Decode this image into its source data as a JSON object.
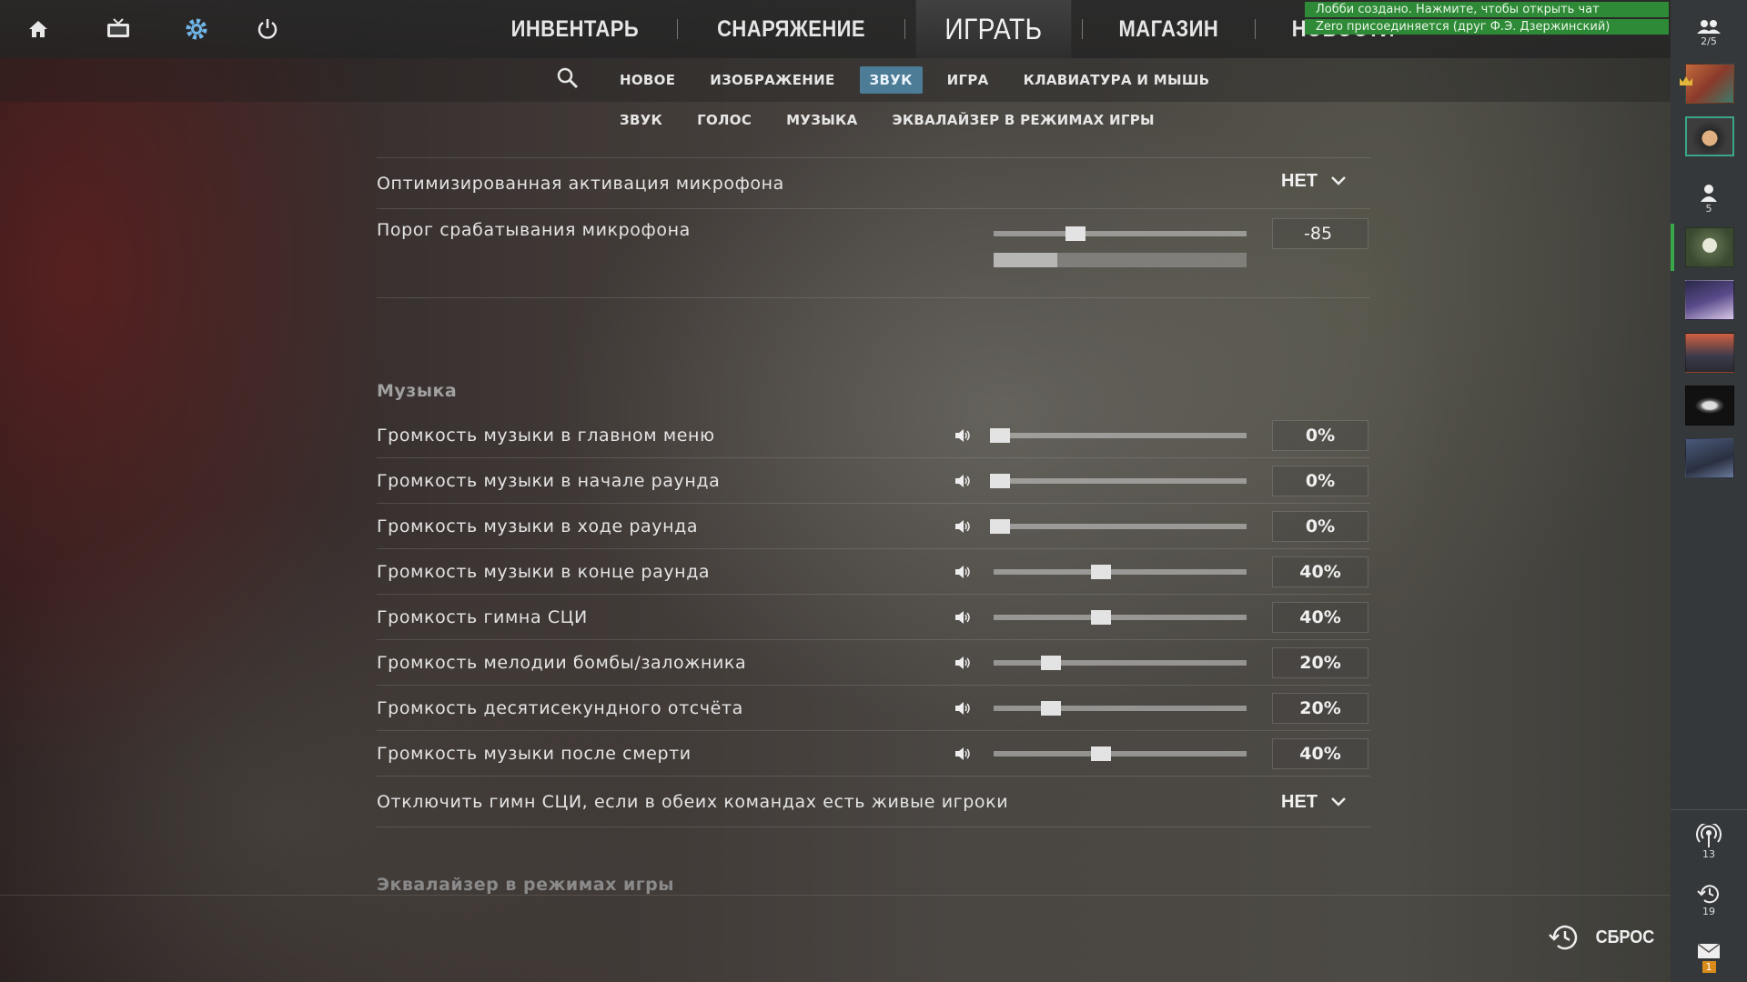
{
  "notifications": [
    "Лобби создано. Нажмите, чтобы открыть чат",
    "Zero присоединяется (друг Ф.Э. Дзержинский)"
  ],
  "top_icons": [
    "home-icon",
    "tv-icon",
    "gear-icon",
    "power-icon"
  ],
  "main_nav": {
    "inventory": "ИНВЕНТАРЬ",
    "loadout": "СНАРЯЖЕНИЕ",
    "play": "ИГРАТЬ",
    "store": "МАГАЗИН",
    "news": "НОВОСТИ"
  },
  "settings_tabs": {
    "new": "НОВОЕ",
    "video": "ИЗОБРАЖЕНИЕ",
    "audio": "ЗВУК",
    "game": "ИГРА",
    "keyboard": "КЛАВИАТУРА И МЫШЬ"
  },
  "audio_subtabs": {
    "sound": "ЗВУК",
    "voice": "ГОЛОС",
    "music": "МУЗЫКА",
    "eq": "ЭКВАЛАЙЗЕР В РЕЖИМАХ ИГРЫ"
  },
  "sidebar": {
    "party_count": "2/5",
    "friends_count": "5",
    "radio_count": "13",
    "history_count": "19",
    "mail_count": "1"
  },
  "mic": {
    "optimized_label": "Оптимизированная активация микрофона",
    "optimized_value": "НЕТ",
    "threshold_label": "Порог срабатывания микрофона",
    "threshold_value": "-85",
    "threshold_fraction": 0.3,
    "level_fraction": 0.25
  },
  "music": {
    "title": "Музыка",
    "rows": [
      {
        "label": "Громкость музыки в главном меню",
        "value": "0%",
        "fraction": 0.0
      },
      {
        "label": "Громкость музыки в начале раунда",
        "value": "0%",
        "fraction": 0.0
      },
      {
        "label": "Громкость музыки в ходе раунда",
        "value": "0%",
        "fraction": 0.0
      },
      {
        "label": "Громкость музыки в конце раунда",
        "value": "40%",
        "fraction": 0.4
      },
      {
        "label": "Громкость гимна СЦИ",
        "value": "40%",
        "fraction": 0.4
      },
      {
        "label": "Громкость мелодии бомбы/заложника",
        "value": "20%",
        "fraction": 0.2
      },
      {
        "label": "Громкость десятисекундного отсчёта",
        "value": "20%",
        "fraction": 0.2
      },
      {
        "label": "Громкость музыки после смерти",
        "value": "40%",
        "fraction": 0.4
      }
    ],
    "mute_anthem_label": "Отключить гимн СЦИ, если в обеих командах есть живые игроки",
    "mute_anthem_value": "НЕТ"
  },
  "eq_section_title": "Эквалайзер в режимах игры",
  "reset_label": "СБРОС"
}
